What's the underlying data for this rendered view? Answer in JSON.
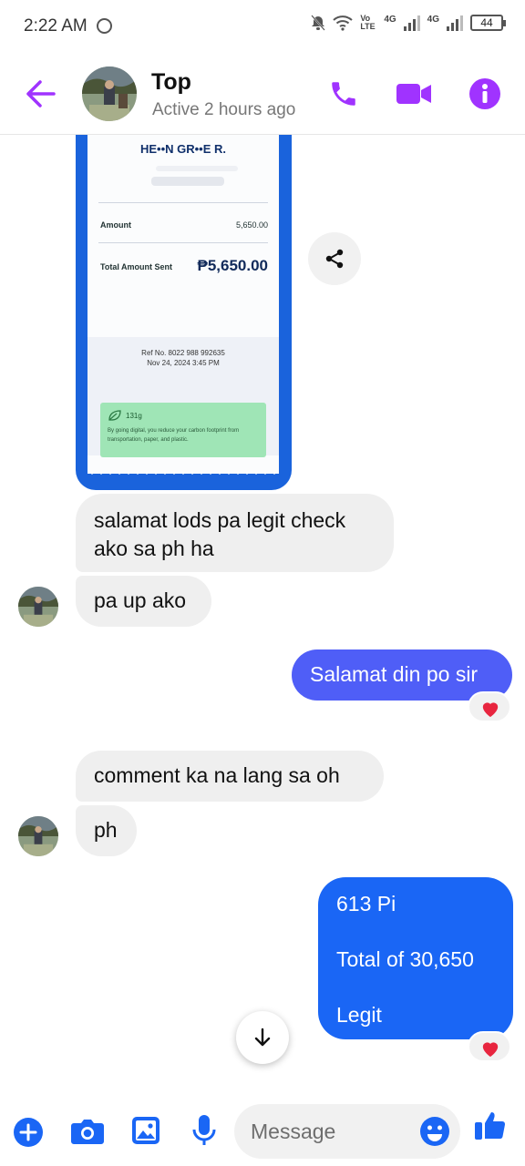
{
  "status_bar": {
    "time": "2:22 AM",
    "volte": "Vo LTE",
    "net1": "4G",
    "net2": "4G",
    "battery": "44"
  },
  "header": {
    "name": "Top",
    "status": "Active 2 hours ago"
  },
  "receipt": {
    "recipient": "HE••N GR••E R.",
    "amount_label": "Amount",
    "amount_value": "5,650.00",
    "total_label": "Total Amount Sent",
    "total_value": "₱5,650.00",
    "ref": "Ref No. 8022 988 992635",
    "date": "Nov 24, 2024 3:45 PM",
    "carbon": "131g",
    "carbon_note": "By going digital, you reduce your carbon footprint from transportation, paper, and plastic."
  },
  "messages": [
    {
      "from": "them",
      "text": "salamat lods pa legit check ako sa ph ha"
    },
    {
      "from": "them",
      "text": "pa up ako"
    },
    {
      "from": "me",
      "text": "Salamat din po sir",
      "reaction": "heart"
    },
    {
      "from": "them",
      "text": "comment ka na lang sa oh"
    },
    {
      "from": "them",
      "text": "ph"
    },
    {
      "from": "me",
      "lines": [
        "613 Pi",
        "Total of 30,650",
        "Legit"
      ],
      "reaction": "heart"
    }
  ],
  "composer": {
    "placeholder": "Message"
  },
  "colors": {
    "accent": "#a033ff",
    "messenger_blue": "#1a66f5",
    "bubble_blue": "#4f5ef7",
    "heart": "#e8253f"
  }
}
